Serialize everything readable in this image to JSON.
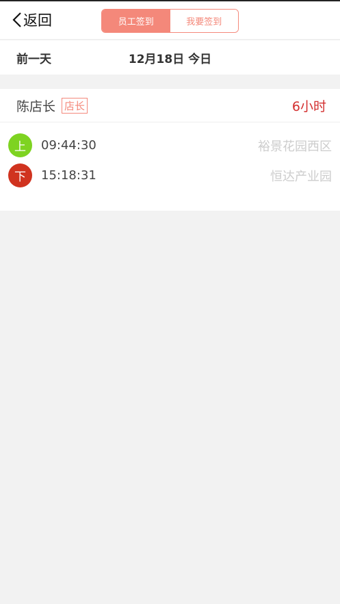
{
  "header": {
    "back_label": "返回",
    "tabs": [
      {
        "label": "员工签到",
        "active": true
      },
      {
        "label": "我要签到",
        "active": false
      }
    ]
  },
  "date_bar": {
    "prev_label": "前一天",
    "current_date": "12月18日 今日"
  },
  "employee": {
    "name": "陈店长",
    "role": "店长",
    "hours": "6小时",
    "records": [
      {
        "type_label": "上",
        "time": "09:44:30",
        "location": "裕景花园西区",
        "color": "#7ed321"
      },
      {
        "type_label": "下",
        "time": "15:18:31",
        "location": "恒达产业园",
        "color": "#d0331f"
      }
    ]
  },
  "colors": {
    "accent": "#f4887a",
    "hours": "#d32f2f",
    "checkin": "#7ed321",
    "checkout": "#d0331f"
  }
}
